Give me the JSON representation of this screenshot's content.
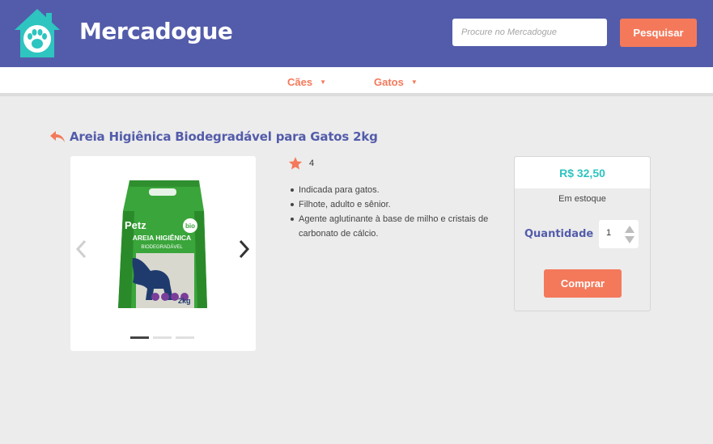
{
  "header": {
    "brand": "Mercadogue",
    "logo_icon": "house-paw-icon",
    "search": {
      "placeholder": "Procure no Mercadogue",
      "value": ""
    },
    "search_button": "Pesquisar"
  },
  "nav": {
    "items": [
      {
        "label": "Cães",
        "icon": "caret-down-icon"
      },
      {
        "label": "Gatos",
        "icon": "caret-down-icon"
      }
    ]
  },
  "product": {
    "back_icon": "back-arrow-icon",
    "title": "Areia Higiênica Biodegradável para Gatos 2kg",
    "image": {
      "brand_text": "Petz",
      "label_line1": "AREIA HIGIÊNICA",
      "label_line2": "BIODEGRADÁVEL",
      "weight": "2kg",
      "badge": "bio"
    },
    "gallery": {
      "slides": 3,
      "active_slide": 1
    },
    "rating": {
      "icon": "star-icon",
      "value": "4"
    },
    "features": [
      "Indicada para gatos.",
      "Filhote, adulto e sênior.",
      "Agente aglutinante à base de milho e cristais de carbonato de cálcio."
    ]
  },
  "purchase": {
    "price": "R$ 32,50",
    "stock": "Em estoque",
    "quantity_label": "Quantidade",
    "quantity": "1",
    "buy_button": "Comprar"
  },
  "colors": {
    "header_bg": "#535caa",
    "accent": "#f4795b",
    "teal": "#2ec4c0",
    "page_bg": "#ececec"
  }
}
